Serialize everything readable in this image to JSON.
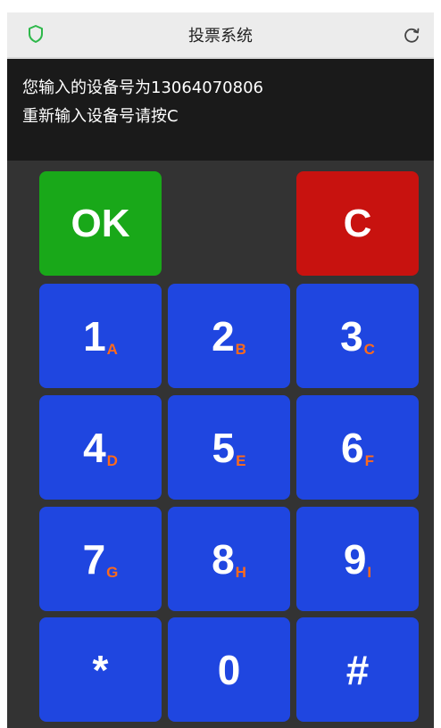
{
  "header": {
    "title": "投票系统",
    "shield_icon": "shield-icon",
    "refresh_icon": "refresh-icon"
  },
  "message": {
    "line1": "您输入的设备号为13064070806",
    "line2": "重新输入设备号请按C"
  },
  "keypad": {
    "ok": "OK",
    "clear": "C",
    "keys": [
      {
        "digit": "1",
        "letter": "A"
      },
      {
        "digit": "2",
        "letter": "B"
      },
      {
        "digit": "3",
        "letter": "C"
      },
      {
        "digit": "4",
        "letter": "D"
      },
      {
        "digit": "5",
        "letter": "E"
      },
      {
        "digit": "6",
        "letter": "F"
      },
      {
        "digit": "7",
        "letter": "G"
      },
      {
        "digit": "8",
        "letter": "H"
      },
      {
        "digit": "9",
        "letter": "I"
      },
      {
        "digit": "*",
        "letter": ""
      },
      {
        "digit": "0",
        "letter": ""
      },
      {
        "digit": "#",
        "letter": ""
      }
    ]
  },
  "colors": {
    "key_blue": "#1f46e0",
    "ok_green": "#19a819",
    "clear_red": "#c8120f",
    "letter_orange": "#ff6a1a",
    "background": "#333333"
  }
}
